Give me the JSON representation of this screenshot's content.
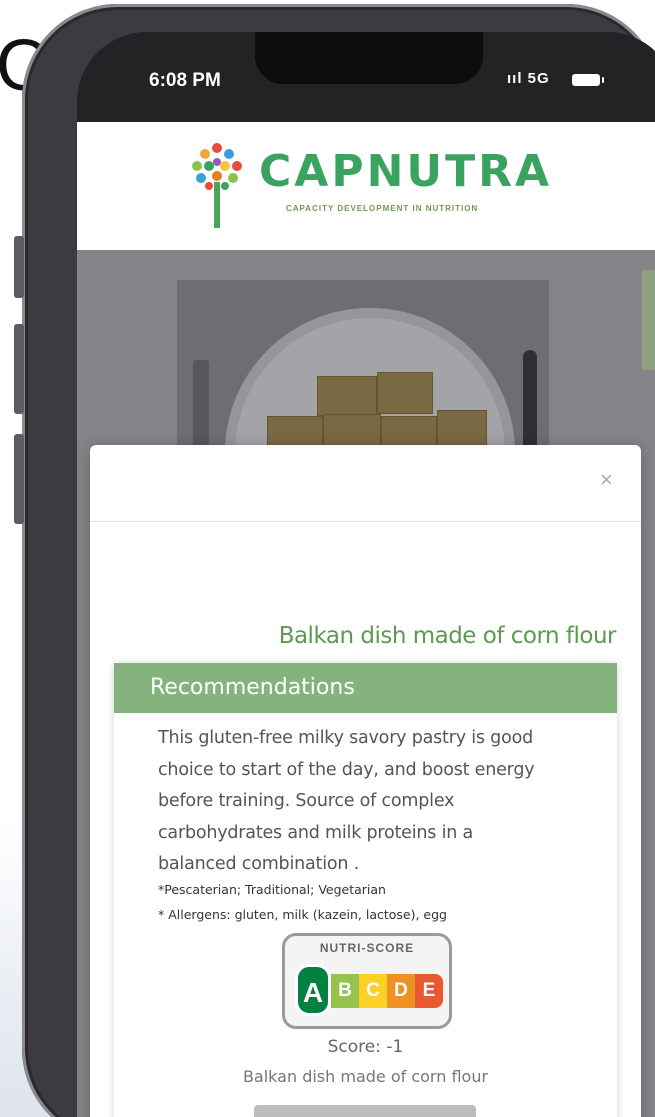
{
  "status_bar": {
    "time": "6:08 PM",
    "signal": "ııl 5G"
  },
  "header": {
    "brand": "CAPNUTRA",
    "tagline": "CAPACITY DEVELOPMENT IN NUTRITION"
  },
  "modal": {
    "close_label": "×",
    "dish_title": "Balkan dish made of corn flour",
    "recommendations": {
      "heading": "Recommendations",
      "lines": [
        "This gluten-free milky savory pastry is good",
        "choice to start of the day, and boost energy",
        "before training. Source of complex",
        "carbohydrates and milk proteins in a",
        "balanced combination ."
      ],
      "tags": "*Pescaterian; Traditional; Vegetarian",
      "allergens": "* Allergens: gluten, milk (kazein, lactose), egg"
    },
    "nutri_score": {
      "title": "NUTRI-SCORE",
      "grades": [
        "A",
        "B",
        "C",
        "D",
        "E"
      ],
      "active": "A",
      "colors": [
        "#038141",
        "#85bb2f",
        "#fecb02",
        "#ee8100",
        "#e63e11"
      ]
    },
    "score_text": "Score: -1",
    "score_caption": "Balkan dish made of corn flour"
  },
  "background_text": "O"
}
